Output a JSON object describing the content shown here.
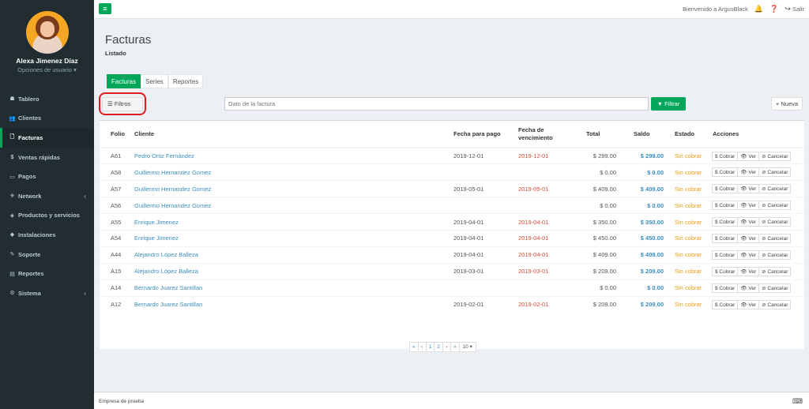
{
  "user": {
    "name": "Alexa Jimenez Díaz",
    "options": "Opciones de usuario ▾"
  },
  "menu": [
    {
      "icon": "☗",
      "label": "Tablero"
    },
    {
      "icon": "👥",
      "label": "Clientes"
    },
    {
      "icon": "🗋",
      "label": "Facturas",
      "active": true
    },
    {
      "icon": "$",
      "label": "Ventas rápidas"
    },
    {
      "icon": "▭",
      "label": "Pagos"
    },
    {
      "icon": "❈",
      "label": "Network",
      "chevron": "‹"
    },
    {
      "icon": "◈",
      "label": "Productos y servicios"
    },
    {
      "icon": "◆",
      "label": "Instalaciones"
    },
    {
      "icon": "✎",
      "label": "Soporte"
    },
    {
      "icon": "▤",
      "label": "Reportes"
    },
    {
      "icon": "⚙",
      "label": "Sistema",
      "chevron": "‹"
    }
  ],
  "topbar": {
    "toggle": "≡",
    "welcome": "Bienvenido a ArgusBlack",
    "bell": "🔔",
    "help": "❓",
    "logout": "Salir",
    "logout_icon": "↪"
  },
  "page": {
    "title": "Facturas",
    "subtitle": "Listado"
  },
  "tabs": [
    "Facturas",
    "Series",
    "Reportes"
  ],
  "filters": {
    "button": "Filtros",
    "button_icon": "☰",
    "search_placeholder": "Dato de la factura",
    "filter_button": "Filtrar",
    "filter_icon": "▼",
    "new_button": "Nueva",
    "new_icon": "+"
  },
  "table": {
    "headers": [
      "Folio",
      "Cliente",
      "Fecha para pago",
      "Fecha de vencimiento",
      "Total",
      "Saldo",
      "Estado",
      "Acciones"
    ],
    "actions": [
      "$ Cobrar",
      "👁 Ver",
      "⊘ Cancelar"
    ],
    "rows": [
      {
        "folio": "A61",
        "cliente": "Pedro Ortiz Fernández",
        "pago": "2019-12-01",
        "venc": "2019-12-01",
        "total": "$ 299.00",
        "saldo": "$ 299.00",
        "estado": "Sin cobrar"
      },
      {
        "folio": "A58",
        "cliente": "Guillermo Hernandez Gomez",
        "pago": "",
        "venc": "",
        "total": "$ 0.00",
        "saldo": "$ 0.00",
        "estado": "Sin cobrar"
      },
      {
        "folio": "A57",
        "cliente": "Guillermo Hernandez Gomez",
        "pago": "2019-05-01",
        "venc": "2019-05-01",
        "total": "$ 409.00",
        "saldo": "$ 409.00",
        "estado": "Sin cobrar"
      },
      {
        "folio": "A56",
        "cliente": "Guillermo Hernandez Gomez",
        "pago": "",
        "venc": "",
        "total": "$ 0.00",
        "saldo": "$ 0.00",
        "estado": "Sin cobrar"
      },
      {
        "folio": "A55",
        "cliente": "Enrique Jimenez",
        "pago": "2019-04-01",
        "venc": "2019-04-01",
        "total": "$ 350.00",
        "saldo": "$ 350.00",
        "estado": "Sin cobrar"
      },
      {
        "folio": "A54",
        "cliente": "Enrique Jimenez",
        "pago": "2019-04-01",
        "venc": "2019-04-01",
        "total": "$ 450.00",
        "saldo": "$ 450.00",
        "estado": "Sin cobrar"
      },
      {
        "folio": "A44",
        "cliente": "Alejandro López Balleza",
        "pago": "2019-04-01",
        "venc": "2019-04-01",
        "total": "$ 409.00",
        "saldo": "$ 409.00",
        "estado": "Sin cobrar"
      },
      {
        "folio": "A15",
        "cliente": "Alejandro López Balleza",
        "pago": "2019-03-01",
        "venc": "2019-03-01",
        "total": "$ 209.00",
        "saldo": "$ 209.00",
        "estado": "Sin cobrar"
      },
      {
        "folio": "A14",
        "cliente": "Bernardo Juarez Santillan",
        "pago": "",
        "venc": "",
        "total": "$ 0.00",
        "saldo": "$ 0.00",
        "estado": "Sin cobrar"
      },
      {
        "folio": "A12",
        "cliente": "Bernardo Juarez Santillan",
        "pago": "2019-02-01",
        "venc": "2019-02-01",
        "total": "$ 209.00",
        "saldo": "$ 209.00",
        "estado": "Sin cobrar"
      }
    ]
  },
  "pagination": {
    "first": "«",
    "prev": "‹",
    "pages": [
      "1",
      "2"
    ],
    "next": "›",
    "last": "»",
    "per_page": "10 ▾"
  },
  "footer": {
    "text": "Empresa de prueba",
    "icon": "⌨"
  }
}
